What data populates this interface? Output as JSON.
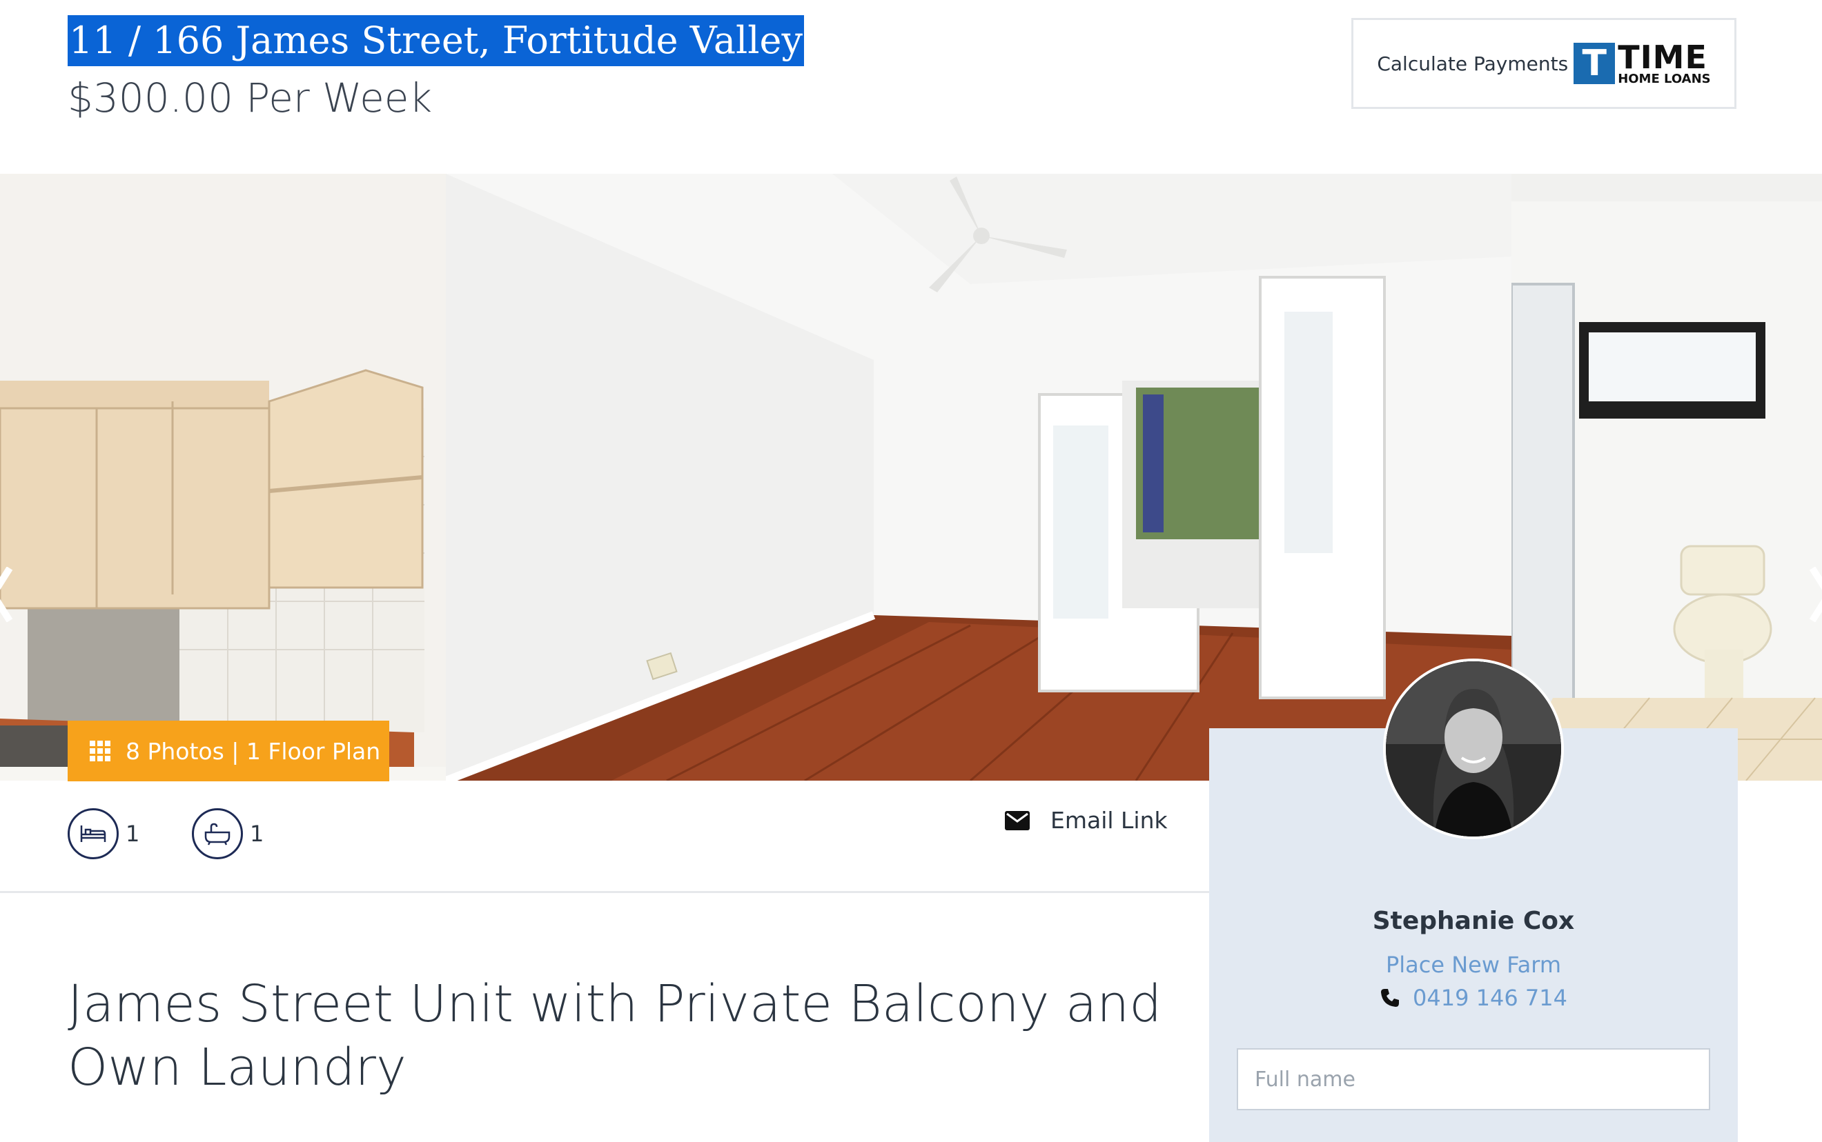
{
  "listing": {
    "address": "11 / 166 James Street, Fortitude Valley",
    "price": "$300.00 Per Week",
    "title": "James Street Unit with Private Balcony and Own Laundry"
  },
  "calculator": {
    "label": "Calculate Payments",
    "logo_mark": "T",
    "logo_name": "TIME",
    "logo_sub": "HOME LOANS"
  },
  "gallery": {
    "photos_button": "8 Photos | 1 Floor Plan",
    "icons": [
      "grid-icon",
      "chevron-left-icon",
      "chevron-right-icon"
    ]
  },
  "features": {
    "bedrooms": "1",
    "bathrooms": "1"
  },
  "actions": {
    "email_link": "Email Link"
  },
  "agent": {
    "name": "Stephanie Cox",
    "office": "Place New Farm",
    "phone": "0419 146 714",
    "form": {
      "fullname_placeholder": "Full name"
    }
  },
  "colors": {
    "accent_orange": "#f7a21b",
    "agent_card_bg": "#e2e9f2",
    "link_blue": "#6a9bd0",
    "selection_blue": "#0a64d6",
    "icon_navy": "#1d2a55"
  }
}
